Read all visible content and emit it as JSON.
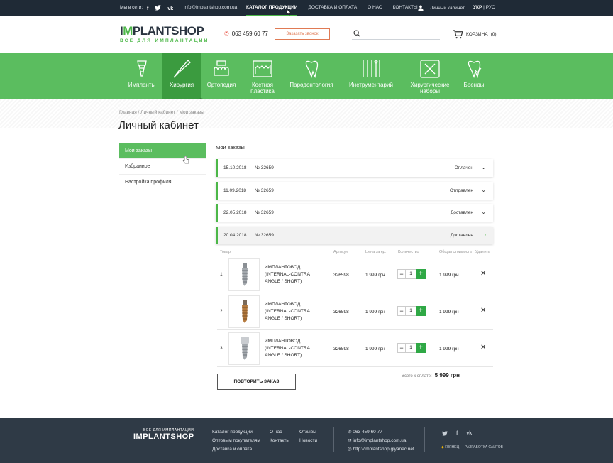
{
  "topbar": {
    "social_label": "Мы в сети:",
    "social": [
      "f",
      "tw",
      "vk"
    ],
    "email": "info@implantshop.com.ua",
    "nav": [
      "КАТАЛОГ ПРОДУКЦИИ",
      "ДОСТАВКА И ОПЛАТА",
      "О НАС",
      "КОНТАКТЫ"
    ],
    "account": "Личный кабинет",
    "lang_active": "УКР",
    "lang_sep": "|",
    "lang_other": "РУС"
  },
  "header": {
    "logo_main_a": "I",
    "logo_main_b": "PLANTSHOP",
    "logo_sub": "ВСЕ ДЛЯ ИМПЛАНТАЦИИ",
    "phone": "063 459 60 77",
    "call_button": "Заказать звонок",
    "search_placeholder": "",
    "cart_label": "КОРЗИНА",
    "cart_count": "(0)"
  },
  "categories": [
    "Импланты",
    "Хирургия",
    "Ортопедия",
    "Костная пластика",
    "Пародонтология",
    "Инструментарий",
    "Хирургические наборы",
    "Бренды"
  ],
  "breadcrumb": {
    "items": [
      "Главная",
      "Личный кабинет",
      "Мои заказы"
    ],
    "sep": " / "
  },
  "page_title": "Личный кабинет",
  "sidebar": [
    "Мои заказы",
    "Избранное",
    "Настройка профиля"
  ],
  "orders_title": "Мои заказы",
  "orders": [
    {
      "date": "15.10.2018",
      "number": "№ 32659",
      "status": "Оплачен"
    },
    {
      "date": "11.09.2018",
      "number": "№ 32659",
      "status": "Отправлен"
    },
    {
      "date": "22.05.2018",
      "number": "№ 32659",
      "status": "Доставлен"
    },
    {
      "date": "20.04.2018",
      "number": "№ 32659",
      "status": "Доставлен"
    }
  ],
  "table_headers": [
    "Товар",
    "Артикул",
    "Цена за ед.",
    "Количество",
    "Общая стоимость",
    "Удалить"
  ],
  "products": [
    {
      "idx": "1",
      "name": "ИМПЛАНТОВОД (INTERNAL-CONTRA ANGLE / SHORT)",
      "article": "326598",
      "price": "1 999 грн",
      "qty": "1",
      "total": "1 999 грн"
    },
    {
      "idx": "2",
      "name": "ИМПЛАНТОВОД (INTERNAL-CONTRA ANGLE / SHORT)",
      "article": "326598",
      "price": "1 999 грн",
      "qty": "1",
      "total": "1 999 грн"
    },
    {
      "idx": "3",
      "name": "ИМПЛАНТОВОД (INTERNAL-CONTRA ANGLE / SHORT)",
      "article": "326598",
      "price": "1 999 грн",
      "qty": "1",
      "total": "1 999 грн"
    }
  ],
  "qty_minus": "−",
  "qty_plus": "+",
  "delete_glyph": "✕",
  "total_label": "Всего к оплате:",
  "total_value": "5 999 грн",
  "repeat_button": "ПОВТОРИТЬ ЗАКАЗ",
  "footer": {
    "logo_top": "ВСЕ ДЛЯ ИМПЛАНТАЦИИ",
    "logo_main": "IMPLANTSHOP",
    "col1": [
      "Каталог продукции",
      "Оптовым покупателям",
      "Доставка и оплата"
    ],
    "col2": [
      "О нас",
      "Контакты"
    ],
    "col3": [
      "Отзывы",
      "Новости"
    ],
    "contacts": [
      "063 459 60 77",
      "info@implantshop.com.ua",
      "http://implantshop.glyanec.net"
    ],
    "social": [
      "tw",
      "f",
      "vk"
    ],
    "developer": "ГЛЯНЕЦ — РАЗРАБОТКА САЙТОВ"
  },
  "colors": {
    "green": "#5bbd5f",
    "green_dark": "#3b9b3f",
    "dark": "#1f2a36",
    "footer": "#2f3a46",
    "accent_orange": "#e07a54"
  }
}
